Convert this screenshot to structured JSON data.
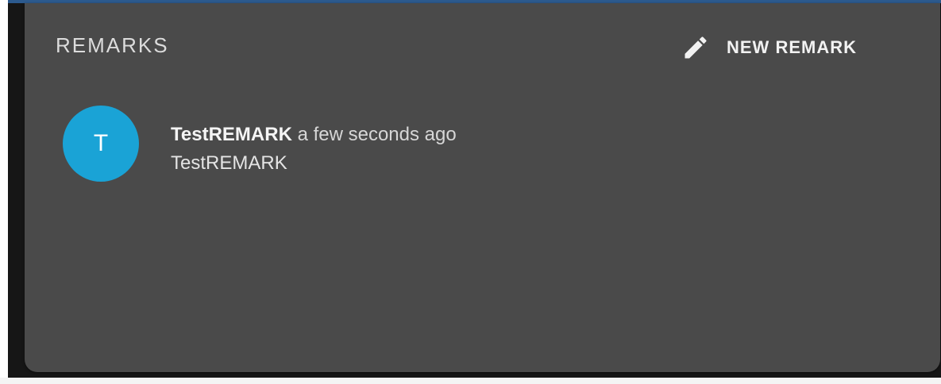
{
  "remarks_panel": {
    "title": "REMARKS",
    "new_remark": {
      "label": "NEW REMARK",
      "icon": "pencil-icon"
    },
    "items": [
      {
        "avatar_initial": "T",
        "avatar_color": "#1aa3d6",
        "author": "TestREMARK",
        "time": "a few seconds ago",
        "text": "TestREMARK"
      }
    ]
  },
  "colors": {
    "card_background": "#4a4a4a",
    "page_background": "#161616"
  }
}
